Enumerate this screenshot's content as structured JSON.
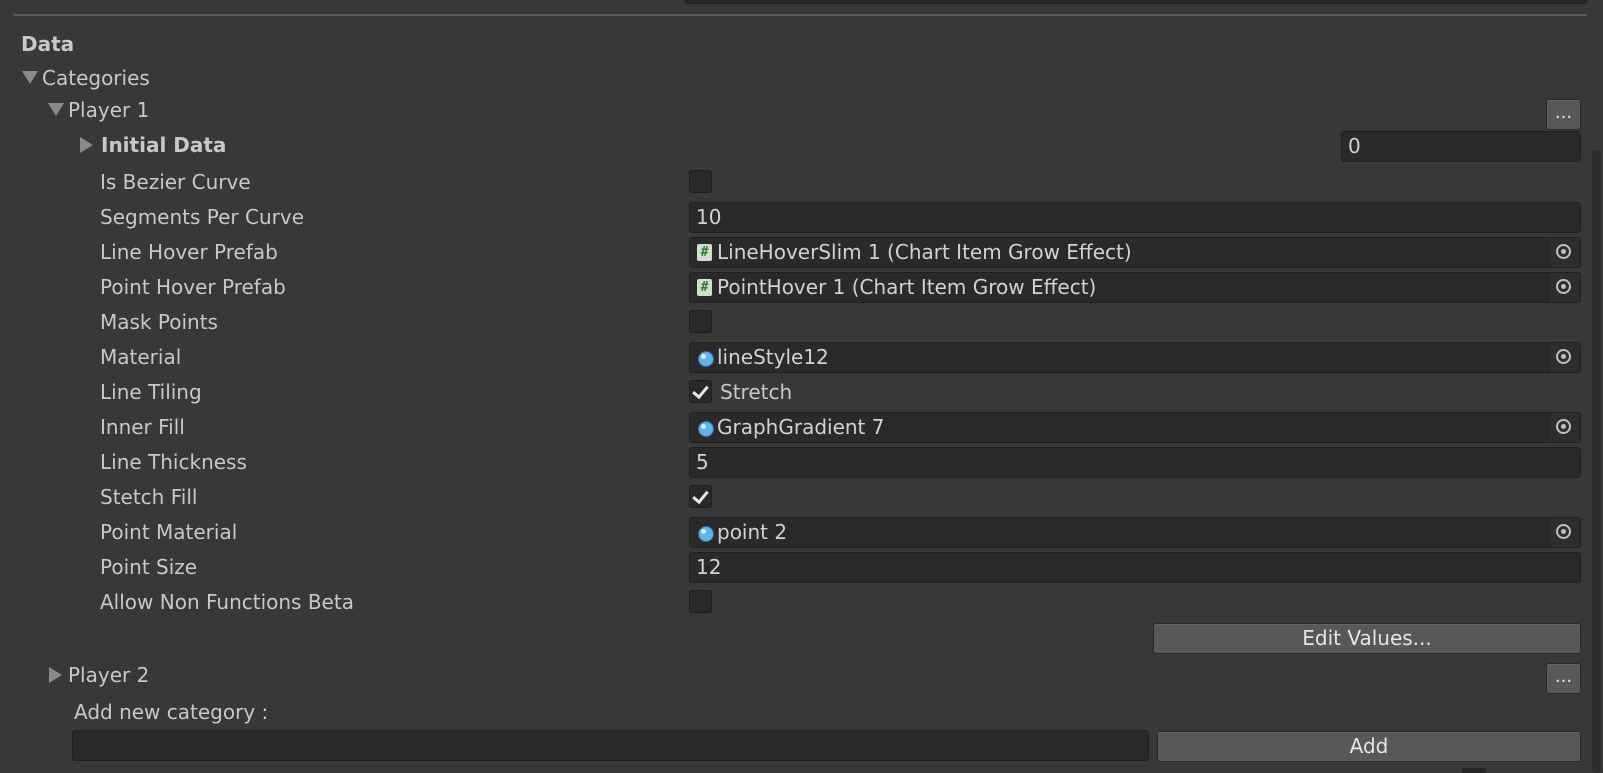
{
  "header": {
    "section_title": "Data"
  },
  "categories": {
    "label": "Categories",
    "player1": {
      "label": "Player 1",
      "menu_label": "...",
      "initial_data": {
        "label": "Initial Data",
        "value": "0"
      },
      "properties": {
        "is_bezier_curve": {
          "label": "Is Bezier Curve",
          "checked": false
        },
        "segments_per_curve": {
          "label": "Segments Per Curve",
          "value": "10"
        },
        "line_hover_prefab": {
          "label": "Line Hover Prefab",
          "value": "LineHoverSlim 1 (Chart Item Grow Effect)",
          "icon": "script-icon"
        },
        "point_hover_prefab": {
          "label": "Point Hover Prefab",
          "value": "PointHover 1 (Chart Item Grow Effect)",
          "icon": "script-icon"
        },
        "mask_points": {
          "label": "Mask Points",
          "checked": false
        },
        "material": {
          "label": "Material",
          "value": "lineStyle12",
          "icon": "material-icon"
        },
        "line_tiling": {
          "label": "Line Tiling",
          "checked": true,
          "value": "Stretch"
        },
        "inner_fill": {
          "label": "Inner Fill",
          "value": "GraphGradient 7",
          "icon": "material-icon"
        },
        "line_thickness": {
          "label": "Line Thickness",
          "value": "5"
        },
        "stetch_fill": {
          "label": "Stetch Fill",
          "checked": true
        },
        "point_material": {
          "label": "Point Material",
          "value": "point 2",
          "icon": "material-icon"
        },
        "point_size": {
          "label": "Point Size",
          "value": "12"
        },
        "allow_non_functions_beta": {
          "label": "Allow Non Functions Beta",
          "checked": false
        }
      },
      "edit_values_label": "Edit Values..."
    },
    "player2": {
      "label": "Player 2",
      "menu_label": "..."
    },
    "add_new_category": {
      "label": "Add new category :",
      "input_value": "",
      "add_label": "Add"
    }
  },
  "colors": {
    "background": "#383838",
    "field": "#2a2a2a",
    "button": "#585858",
    "text": "#c8c8c8",
    "material_icon": "#5fb3e8"
  }
}
